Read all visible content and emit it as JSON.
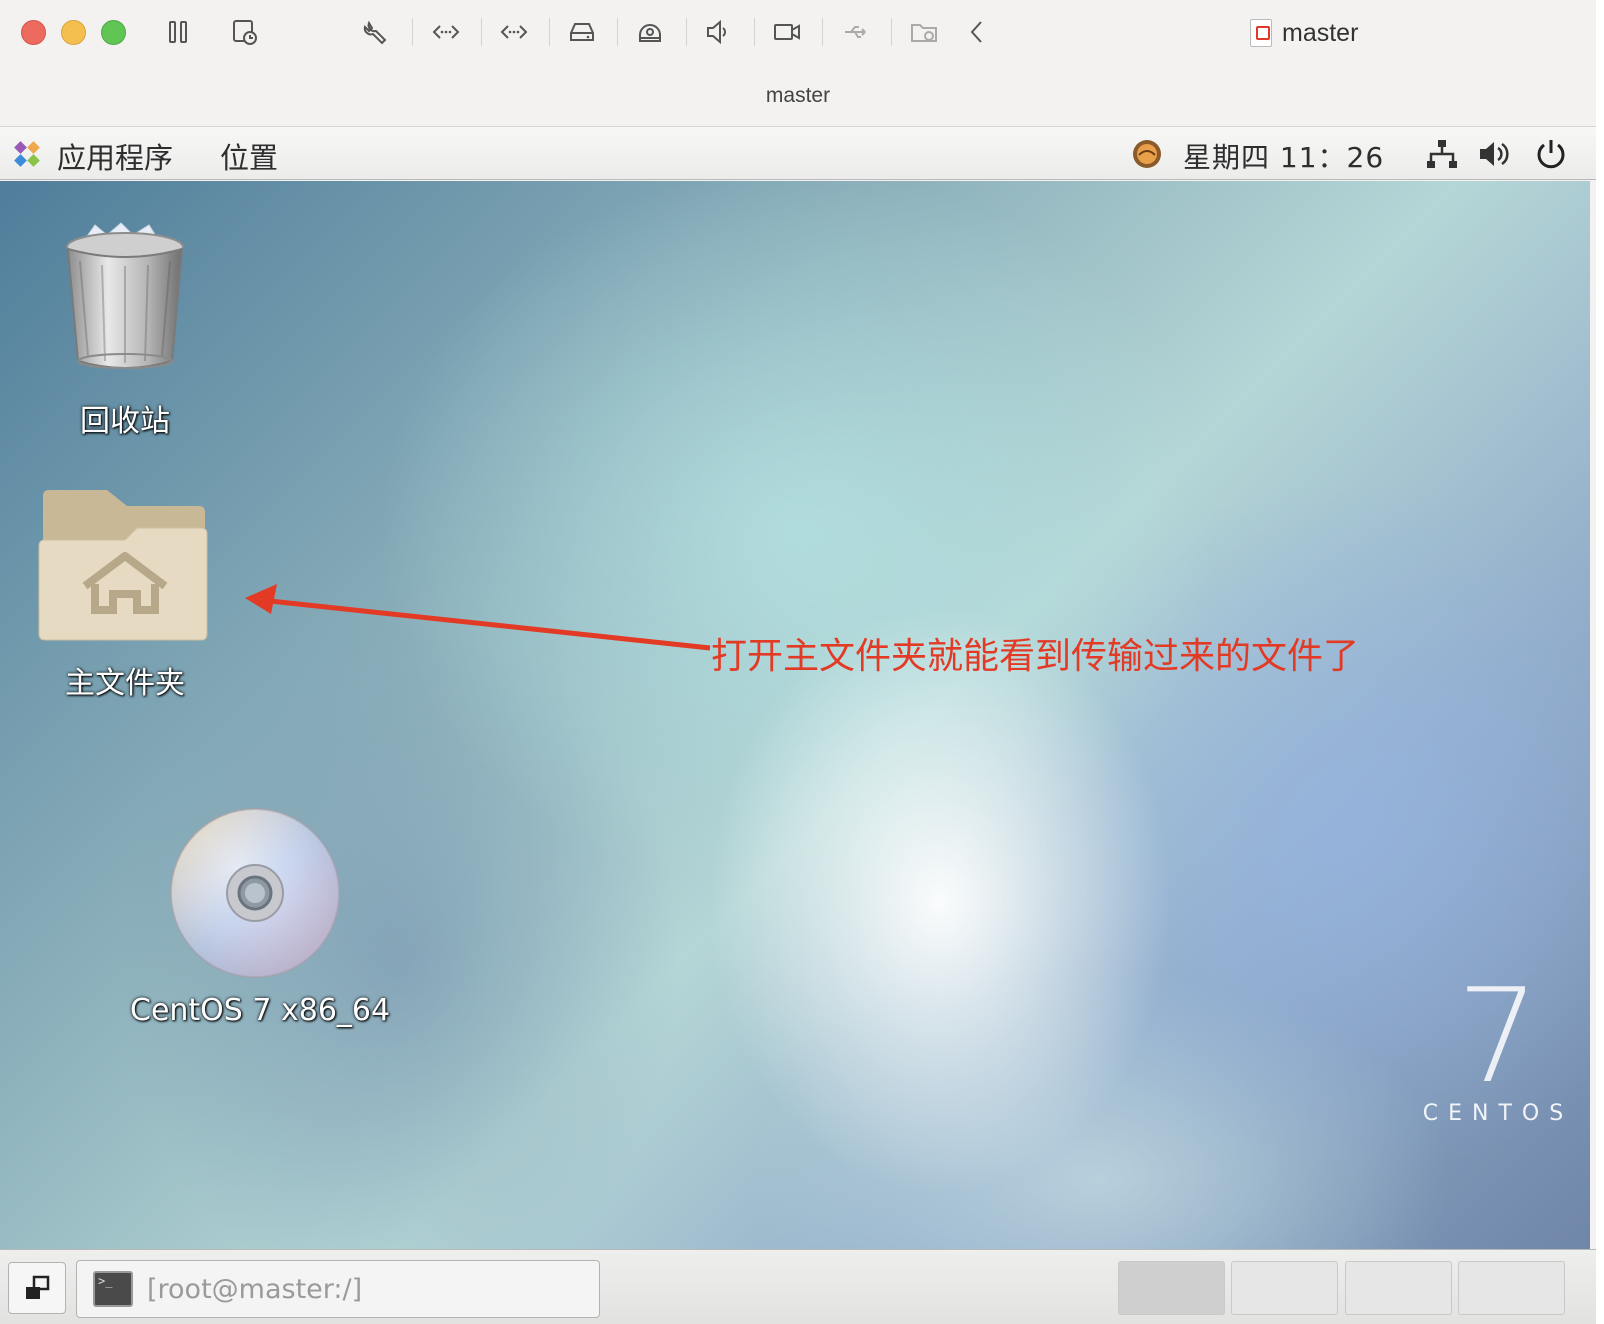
{
  "mac_window": {
    "tab_title": "master",
    "window_title": "master",
    "toolbar_icons": [
      "pause-icon",
      "snapshot-icon",
      "settings-wrench-icon",
      "network-adapter-1-icon",
      "network-adapter-2-icon",
      "hard-disk-icon",
      "cd-dvd-icon",
      "sound-icon",
      "camera-icon",
      "usb-icon",
      "shared-folder-icon",
      "collapse-chevron-icon"
    ]
  },
  "gnome_panel": {
    "applications_label": "应用程序",
    "places_label": "位置",
    "clock": "星期四 11：26",
    "status_icons": [
      "weather-icon",
      "network-icon",
      "volume-icon",
      "power-icon"
    ]
  },
  "desktop": {
    "icons": [
      {
        "label": "回收站",
        "icon": "trash-icon"
      },
      {
        "label": "主文件夹",
        "icon": "home-folder-icon"
      },
      {
        "label": "CentOS 7 x86_64",
        "icon": "cdrom-icon"
      }
    ],
    "annotation": "打开主文件夹就能看到传输过来的文件了",
    "annotation_color": "#e23a24",
    "branding": {
      "version": "7",
      "name": "CENTOS"
    }
  },
  "taskbar": {
    "window_list": [
      {
        "label": "[root@master:/]"
      }
    ],
    "workspaces": 4
  }
}
